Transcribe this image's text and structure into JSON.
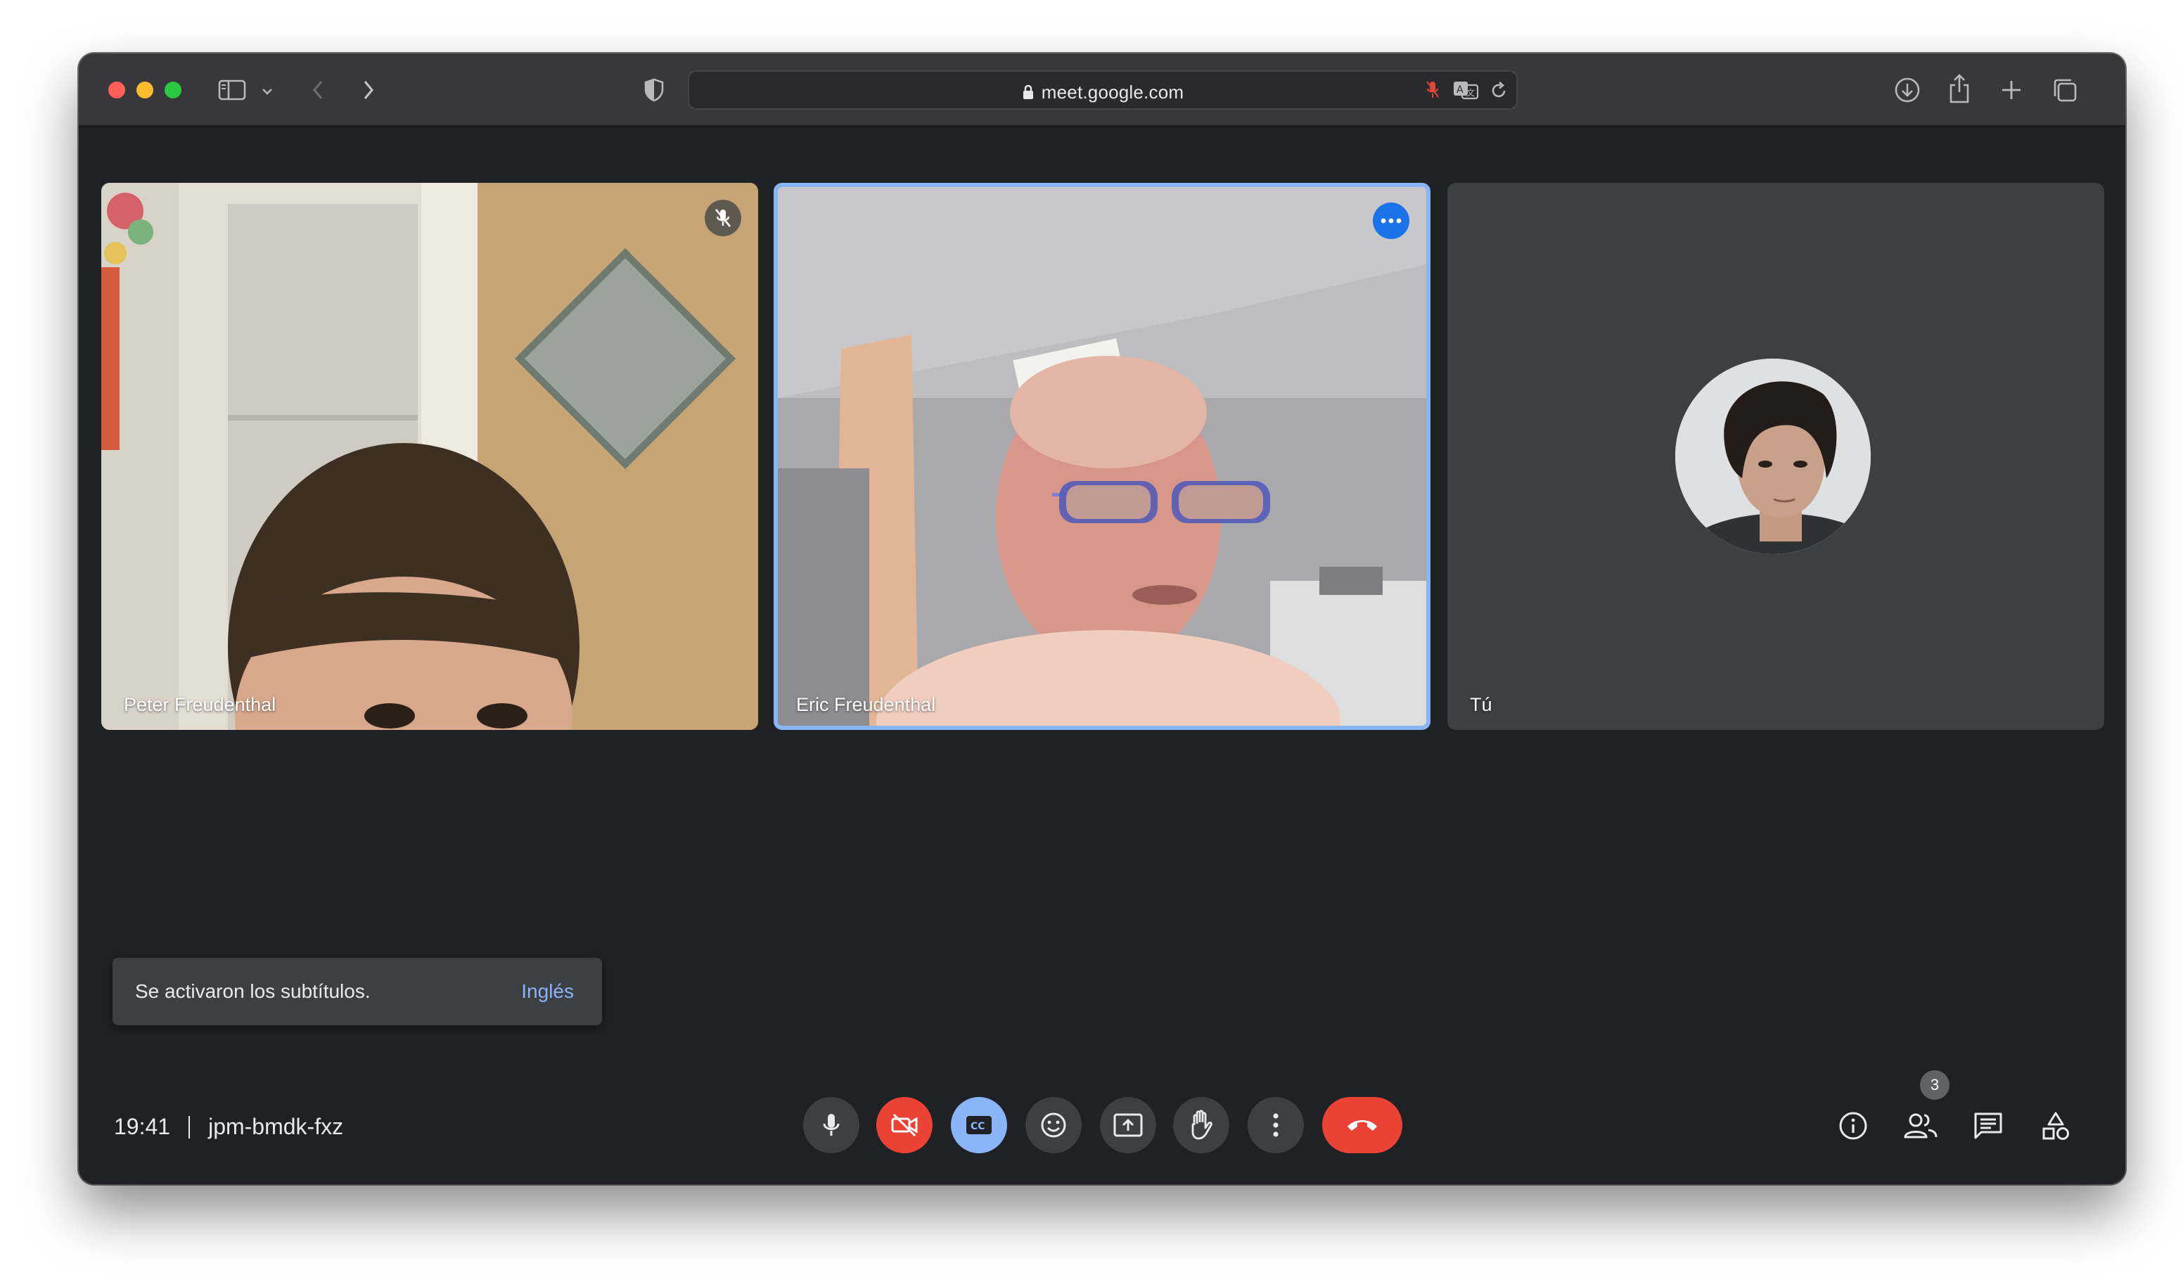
{
  "browser": {
    "url": "meet.google.com"
  },
  "participants": [
    {
      "name": "Peter Freudenthal",
      "muted": true
    },
    {
      "name": "Eric Freudenthal",
      "speaking": true
    },
    {
      "name": "Tú"
    }
  ],
  "toast": {
    "message": "Se activaron los subtítulos.",
    "action": "Inglés"
  },
  "meeting": {
    "time": "19:41",
    "code": "jpm-bmdk-fxz"
  },
  "people_count": "3",
  "colors": {
    "background": "#202124",
    "tile": "#3c4043",
    "accent_blue": "#8ab4f8",
    "hangup_red": "#ea4335"
  }
}
